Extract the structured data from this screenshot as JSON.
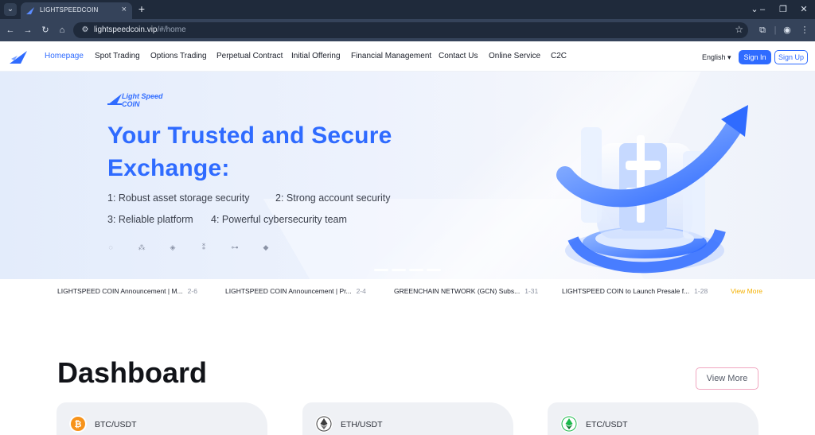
{
  "browser": {
    "tab_title": "LIGHTSPEEDCOIN",
    "url_domain": "lightspeedcoin.vip",
    "url_path": "/#/home"
  },
  "header": {
    "nav": [
      {
        "label": "Homepage",
        "active": true
      },
      {
        "label": "Spot Trading",
        "active": false
      },
      {
        "label": "Options Trading",
        "active": false
      },
      {
        "label": "Perpetual Contract",
        "active": false
      },
      {
        "label": "Initial Offering",
        "active": false
      },
      {
        "label": "Financial Management",
        "active": false
      },
      {
        "label": "Contact Us",
        "active": false
      },
      {
        "label": "Online Service",
        "active": false
      },
      {
        "label": "C2C",
        "active": false
      }
    ],
    "language": "English",
    "sign_in": "Sign In",
    "sign_up": "Sign Up",
    "accent_color": "#2f6bff"
  },
  "hero": {
    "brand_line1": "Light Speed",
    "brand_line2": "COIN",
    "title": "Your Trusted and Secure Exchange:",
    "features": [
      "1: Robust asset storage security",
      "2: Strong account security",
      "3: Reliable platform",
      "4: Powerful cybersecurity team"
    ]
  },
  "announcements": [
    {
      "title": "LIGHTSPEED COIN Announcement | M...",
      "date": "2-6"
    },
    {
      "title": "LIGHTSPEED COIN Announcement | Pr...",
      "date": "2-4"
    },
    {
      "title": "GREENCHAIN NETWORK (GCN) Subs...",
      "date": "1-31"
    },
    {
      "title": "LIGHTSPEED COIN to Launch Presale f...",
      "date": "1-28"
    }
  ],
  "announcements_more": "View More",
  "dashboard": {
    "title": "Dashboard",
    "view_more": "View More",
    "pairs": [
      {
        "pair": "BTC/USDT",
        "icon": "bitcoin-icon",
        "color": "#f7931a"
      },
      {
        "pair": "ETH/USDT",
        "icon": "ethereum-icon",
        "color": "#3c3c3d"
      },
      {
        "pair": "ETC/USDT",
        "icon": "ethereum-classic-icon",
        "color": "#1cb84c"
      }
    ]
  }
}
